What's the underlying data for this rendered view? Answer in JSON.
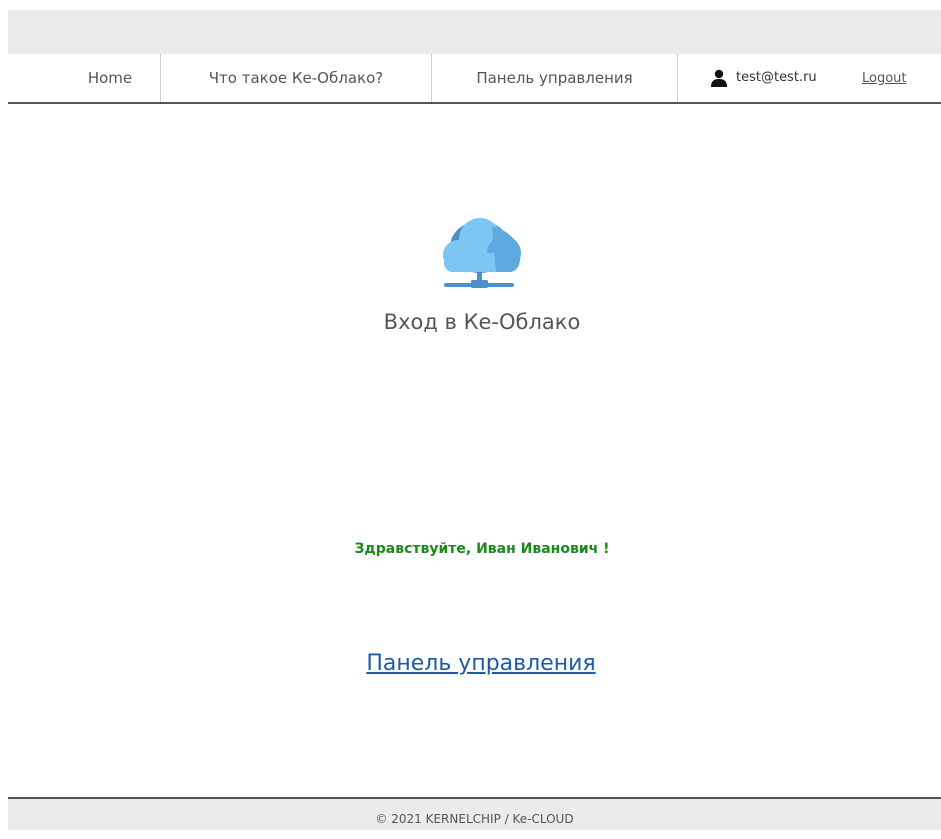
{
  "nav": {
    "home_label": "Home",
    "what_label": "Что такое Ке-Облако?",
    "panel_label": "Панель управления",
    "user_email": "test@test.ru",
    "logout_label": "Logout"
  },
  "main": {
    "logo_icon": "cloud-network-icon",
    "login_title": "Вход в Ке-Облако",
    "greeting": "Здравствуйте, Иван Иванович !",
    "panel_link": "Панель управления"
  },
  "footer": {
    "copyright": "© 2021 KERNELCHIP / Ke-CLOUD"
  },
  "colors": {
    "greeting": "#1a8a1a",
    "link": "#1f5aa6",
    "cloud_light": "#7cc6f3",
    "cloud_dark": "#4d8fc9",
    "border": "#555555",
    "bar_bg": "#ebebeb"
  }
}
